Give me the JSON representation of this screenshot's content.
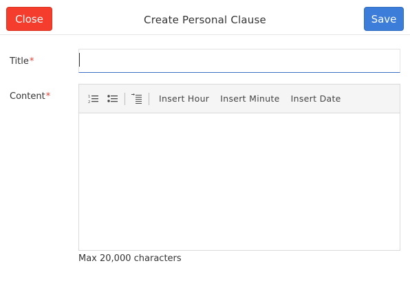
{
  "header": {
    "close_label": "Close",
    "title": "Create Personal Clause",
    "save_label": "Save"
  },
  "form": {
    "title_label": "Title",
    "title_value": "",
    "required_marker": "*",
    "content_label": "Content",
    "content_value": "",
    "content_hint": "Max 20,000 characters"
  },
  "toolbar": {
    "icons": [
      "numbered-list-icon",
      "bulleted-list-icon",
      "indent-icon"
    ],
    "insert_hour": "Insert Hour",
    "insert_minute": "Insert Minute",
    "insert_date": "Insert Date"
  },
  "colors": {
    "close": "#f53d2d",
    "save": "#3b7dd8",
    "required": "#e03a2c",
    "input_focus": "#3b6fc4"
  }
}
